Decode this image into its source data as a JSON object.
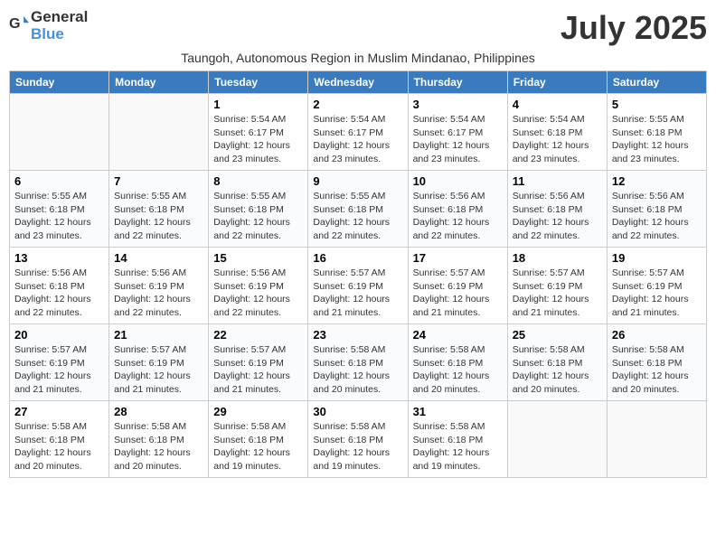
{
  "header": {
    "logo_general": "General",
    "logo_blue": "Blue",
    "month_title": "July 2025",
    "subtitle": "Taungoh, Autonomous Region in Muslim Mindanao, Philippines"
  },
  "days_of_week": [
    "Sunday",
    "Monday",
    "Tuesday",
    "Wednesday",
    "Thursday",
    "Friday",
    "Saturday"
  ],
  "weeks": [
    [
      {
        "day": "",
        "info": ""
      },
      {
        "day": "",
        "info": ""
      },
      {
        "day": "1",
        "info": "Sunrise: 5:54 AM\nSunset: 6:17 PM\nDaylight: 12 hours and 23 minutes."
      },
      {
        "day": "2",
        "info": "Sunrise: 5:54 AM\nSunset: 6:17 PM\nDaylight: 12 hours and 23 minutes."
      },
      {
        "day": "3",
        "info": "Sunrise: 5:54 AM\nSunset: 6:17 PM\nDaylight: 12 hours and 23 minutes."
      },
      {
        "day": "4",
        "info": "Sunrise: 5:54 AM\nSunset: 6:18 PM\nDaylight: 12 hours and 23 minutes."
      },
      {
        "day": "5",
        "info": "Sunrise: 5:55 AM\nSunset: 6:18 PM\nDaylight: 12 hours and 23 minutes."
      }
    ],
    [
      {
        "day": "6",
        "info": "Sunrise: 5:55 AM\nSunset: 6:18 PM\nDaylight: 12 hours and 23 minutes."
      },
      {
        "day": "7",
        "info": "Sunrise: 5:55 AM\nSunset: 6:18 PM\nDaylight: 12 hours and 22 minutes."
      },
      {
        "day": "8",
        "info": "Sunrise: 5:55 AM\nSunset: 6:18 PM\nDaylight: 12 hours and 22 minutes."
      },
      {
        "day": "9",
        "info": "Sunrise: 5:55 AM\nSunset: 6:18 PM\nDaylight: 12 hours and 22 minutes."
      },
      {
        "day": "10",
        "info": "Sunrise: 5:56 AM\nSunset: 6:18 PM\nDaylight: 12 hours and 22 minutes."
      },
      {
        "day": "11",
        "info": "Sunrise: 5:56 AM\nSunset: 6:18 PM\nDaylight: 12 hours and 22 minutes."
      },
      {
        "day": "12",
        "info": "Sunrise: 5:56 AM\nSunset: 6:18 PM\nDaylight: 12 hours and 22 minutes."
      }
    ],
    [
      {
        "day": "13",
        "info": "Sunrise: 5:56 AM\nSunset: 6:18 PM\nDaylight: 12 hours and 22 minutes."
      },
      {
        "day": "14",
        "info": "Sunrise: 5:56 AM\nSunset: 6:19 PM\nDaylight: 12 hours and 22 minutes."
      },
      {
        "day": "15",
        "info": "Sunrise: 5:56 AM\nSunset: 6:19 PM\nDaylight: 12 hours and 22 minutes."
      },
      {
        "day": "16",
        "info": "Sunrise: 5:57 AM\nSunset: 6:19 PM\nDaylight: 12 hours and 21 minutes."
      },
      {
        "day": "17",
        "info": "Sunrise: 5:57 AM\nSunset: 6:19 PM\nDaylight: 12 hours and 21 minutes."
      },
      {
        "day": "18",
        "info": "Sunrise: 5:57 AM\nSunset: 6:19 PM\nDaylight: 12 hours and 21 minutes."
      },
      {
        "day": "19",
        "info": "Sunrise: 5:57 AM\nSunset: 6:19 PM\nDaylight: 12 hours and 21 minutes."
      }
    ],
    [
      {
        "day": "20",
        "info": "Sunrise: 5:57 AM\nSunset: 6:19 PM\nDaylight: 12 hours and 21 minutes."
      },
      {
        "day": "21",
        "info": "Sunrise: 5:57 AM\nSunset: 6:19 PM\nDaylight: 12 hours and 21 minutes."
      },
      {
        "day": "22",
        "info": "Sunrise: 5:57 AM\nSunset: 6:19 PM\nDaylight: 12 hours and 21 minutes."
      },
      {
        "day": "23",
        "info": "Sunrise: 5:58 AM\nSunset: 6:18 PM\nDaylight: 12 hours and 20 minutes."
      },
      {
        "day": "24",
        "info": "Sunrise: 5:58 AM\nSunset: 6:18 PM\nDaylight: 12 hours and 20 minutes."
      },
      {
        "day": "25",
        "info": "Sunrise: 5:58 AM\nSunset: 6:18 PM\nDaylight: 12 hours and 20 minutes."
      },
      {
        "day": "26",
        "info": "Sunrise: 5:58 AM\nSunset: 6:18 PM\nDaylight: 12 hours and 20 minutes."
      }
    ],
    [
      {
        "day": "27",
        "info": "Sunrise: 5:58 AM\nSunset: 6:18 PM\nDaylight: 12 hours and 20 minutes."
      },
      {
        "day": "28",
        "info": "Sunrise: 5:58 AM\nSunset: 6:18 PM\nDaylight: 12 hours and 20 minutes."
      },
      {
        "day": "29",
        "info": "Sunrise: 5:58 AM\nSunset: 6:18 PM\nDaylight: 12 hours and 19 minutes."
      },
      {
        "day": "30",
        "info": "Sunrise: 5:58 AM\nSunset: 6:18 PM\nDaylight: 12 hours and 19 minutes."
      },
      {
        "day": "31",
        "info": "Sunrise: 5:58 AM\nSunset: 6:18 PM\nDaylight: 12 hours and 19 minutes."
      },
      {
        "day": "",
        "info": ""
      },
      {
        "day": "",
        "info": ""
      }
    ]
  ]
}
